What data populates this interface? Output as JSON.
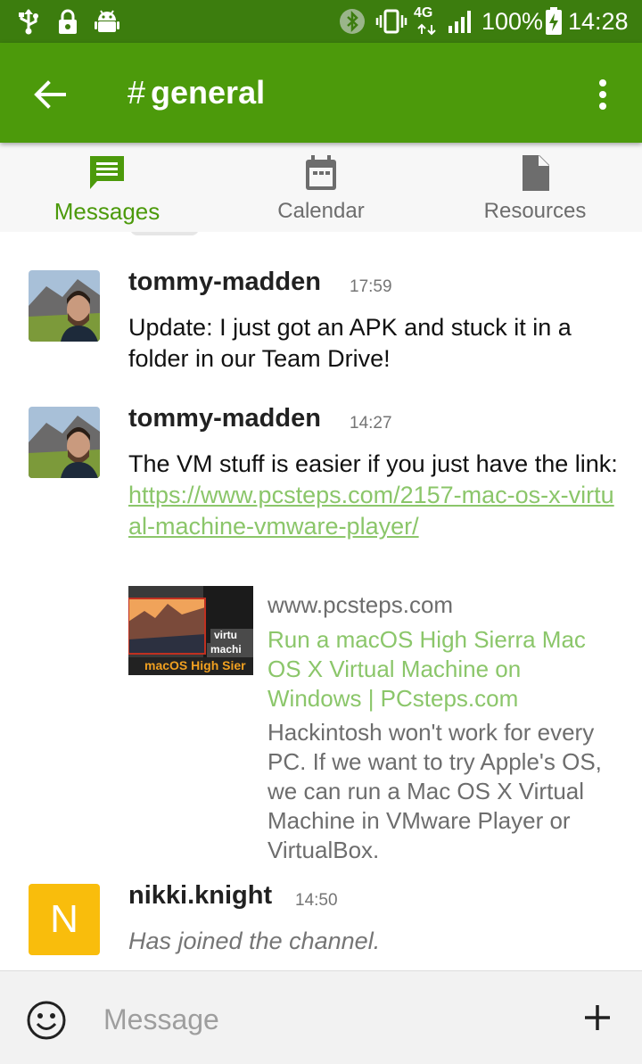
{
  "status_bar": {
    "network": "4G",
    "battery": "100%",
    "time": "14:28",
    "left_icons": [
      "usb-icon",
      "lock-icon",
      "android-icon"
    ],
    "right_icons": [
      "bluetooth-icon",
      "vibrate-icon",
      "signal-icon",
      "battery-charging-icon"
    ]
  },
  "app_bar": {
    "hash": "#",
    "title": "general",
    "back_icon": "arrow-back-icon",
    "menu_icon": "more-vert-icon",
    "color": "#4c9a0b"
  },
  "tabs": [
    {
      "label": "Messages",
      "icon": "chat-icon",
      "active": true
    },
    {
      "label": "Calendar",
      "icon": "calendar-icon",
      "active": false
    },
    {
      "label": "Resources",
      "icon": "file-icon",
      "active": false
    }
  ],
  "messages": [
    {
      "author": "tommy-madden",
      "time": "17:59",
      "text": "Update: I just got an APK and stuck it in a folder in our Team Drive!"
    },
    {
      "author": "tommy-madden",
      "time": "14:27",
      "text_before_link": "The VM stuff is easier if you just have the link: ",
      "link": "https://www.pcsteps.com/2157-mac-os-x-virtual-machine-vmware-player/",
      "preview": {
        "domain": "www.pcsteps.com",
        "title": "Run a macOS High Sierra Mac OS X Virtual Machine on Windows | PCsteps.com",
        "description": "Hackintosh won't work for every PC. If we want to try Apple's OS, we can run a Mac OS X Virtual Machine in VMware Player or VirtualBox.",
        "thumb_text": [
          "virtu",
          "machi",
          "macOS High Sier"
        ]
      }
    },
    {
      "author": "nikki.knight",
      "time": "14:50",
      "avatar_letter": "N",
      "text": "Has joined the channel."
    }
  ],
  "composer": {
    "placeholder": "Message",
    "emoji_icon": "emoji-icon",
    "add_icon": "plus-icon"
  },
  "colors": {
    "primary": "#4c9a0b",
    "status_bar": "#3c7d0e",
    "link": "#8bc66a",
    "avatar_n": "#f9bd0c"
  }
}
